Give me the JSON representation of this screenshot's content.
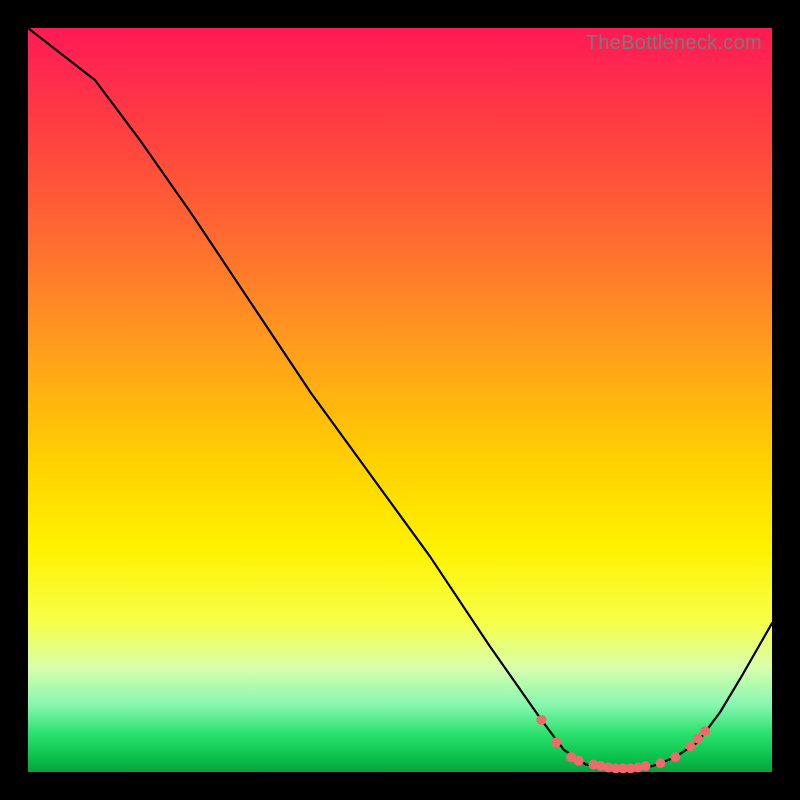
{
  "watermark": "TheBottleneck.com",
  "chart_data": {
    "type": "line",
    "title": "",
    "xlabel": "",
    "ylabel": "",
    "xlim": [
      0,
      100
    ],
    "ylim": [
      0,
      100
    ],
    "series": [
      {
        "name": "bottleneck-curve",
        "x": [
          0,
          9,
          15,
          22,
          30,
          38,
          46,
          54,
          62,
          69,
          72,
          75,
          78,
          81,
          84,
          87,
          90,
          93,
          96,
          100
        ],
        "values": [
          100,
          93,
          85,
          75,
          63,
          51,
          40,
          29,
          17,
          7,
          3,
          1,
          0.5,
          0.5,
          0.8,
          2,
          4,
          8,
          13,
          20
        ]
      }
    ],
    "markers": {
      "name": "highlight-points",
      "x": [
        69,
        71,
        73,
        74,
        76,
        77,
        78,
        79,
        80,
        81,
        82,
        83,
        85,
        87,
        89,
        90,
        91
      ],
      "values": [
        7,
        4,
        2,
        1.5,
        1,
        0.8,
        0.6,
        0.5,
        0.5,
        0.5,
        0.6,
        0.8,
        1.2,
        2,
        3.5,
        4.5,
        5.5
      ]
    },
    "colors": {
      "curve": "#000000",
      "marker": "#ef6a6a",
      "gradient_top": "#ff1a55",
      "gradient_mid": "#fff200",
      "gradient_bottom": "#06a33c"
    }
  }
}
